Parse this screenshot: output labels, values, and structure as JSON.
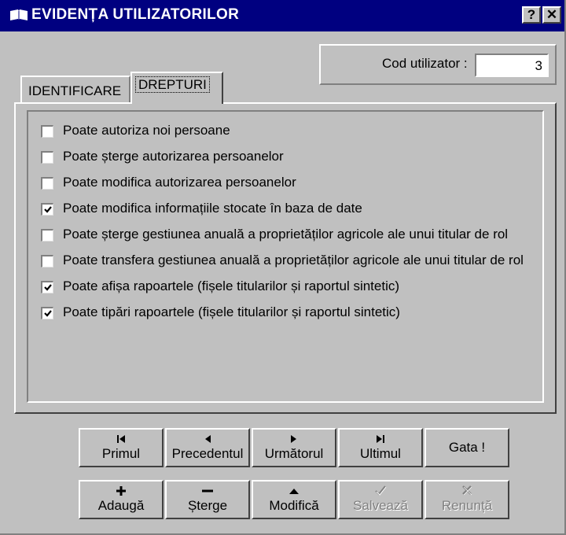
{
  "window": {
    "title": "EVIDENȚA UTILIZATORILOR",
    "help_glyph": "?",
    "close_glyph": "✕",
    "title_icon": "book-icon"
  },
  "user_code": {
    "label": "Cod utilizator :",
    "value": "3"
  },
  "tabs": [
    {
      "label": "IDENTIFICARE",
      "active": false
    },
    {
      "label": "DREPTURI",
      "active": true
    }
  ],
  "permissions": [
    {
      "label": "Poate autoriza noi persoane",
      "checked": false
    },
    {
      "label": "Poate șterge autorizarea persoanelor",
      "checked": false
    },
    {
      "label": "Poate modifica autorizarea persoanelor",
      "checked": false
    },
    {
      "label": "Poate modifica informațiile stocate în baza de date",
      "checked": true
    },
    {
      "label": "Poate șterge gestiunea anuală a proprietăților agricole ale unui titular de rol",
      "checked": false
    },
    {
      "label": "Poate transfera gestiunea anuală a proprietăților agricole ale unui titular de rol",
      "checked": false
    },
    {
      "label": "Poate afișa rapoartele (fișele titularilor și raportul sintetic)",
      "checked": true
    },
    {
      "label": "Poate tipări rapoartele (fișele titularilor și raportul sintetic)",
      "checked": true
    }
  ],
  "nav_buttons": [
    {
      "label": "Primul",
      "icon": "first-record-icon",
      "enabled": true
    },
    {
      "label": "Precedentul",
      "icon": "previous-record-icon",
      "enabled": true
    },
    {
      "label": "Următorul",
      "icon": "next-record-icon",
      "enabled": true
    },
    {
      "label": "Ultimul",
      "icon": "last-record-icon",
      "enabled": true
    },
    {
      "label": "Gata !",
      "icon": "",
      "enabled": true
    }
  ],
  "action_buttons": [
    {
      "label": "Adaugă",
      "icon": "plus-icon",
      "enabled": true
    },
    {
      "label": "Șterge",
      "icon": "minus-icon",
      "enabled": true
    },
    {
      "label": "Modifică",
      "icon": "triangle-up-icon",
      "enabled": true
    },
    {
      "label": "Salvează",
      "icon": "check-icon",
      "enabled": false
    },
    {
      "label": "Renunță",
      "icon": "cancel-icon",
      "enabled": false
    }
  ],
  "colors": {
    "title_bar": "#000080",
    "face": "#c0c0c0",
    "disabled_text": "#808080"
  }
}
